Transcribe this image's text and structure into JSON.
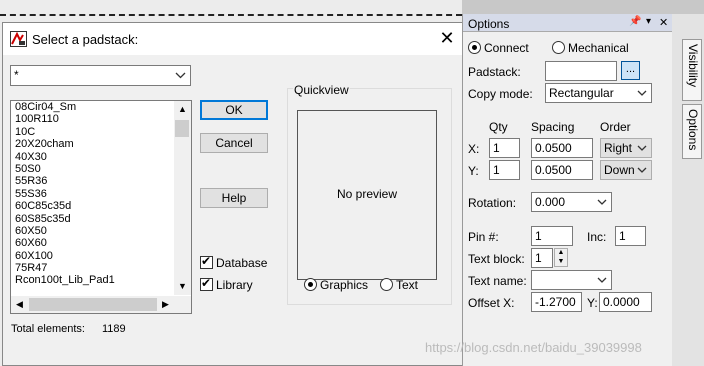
{
  "dialog": {
    "title": "Select a padstack:",
    "filter_value": "*",
    "list_items": [
      "08Cir04_Sm",
      "100R110",
      "10C",
      "20X20cham",
      "40X30",
      "50S0",
      "55R36",
      "55S36",
      "60C85c35d",
      "60S85c35d",
      "60X50",
      "60X60",
      "60X100",
      "75R47",
      "Rcon100t_Lib_Pad1"
    ],
    "buttons": {
      "ok": "OK",
      "cancel": "Cancel",
      "help": "Help"
    },
    "checks": {
      "database": "Database",
      "library": "Library"
    },
    "quickview": {
      "label": "Quickview",
      "preview_text": "No preview",
      "graphics": "Graphics",
      "text": "Text"
    },
    "total_label": "Total elements:",
    "total_value": "1189"
  },
  "options": {
    "title": "Options",
    "connect": "Connect",
    "mechanical": "Mechanical",
    "padstack_label": "Padstack:",
    "padstack_value": "",
    "browse_label": "...",
    "copy_mode_label": "Copy mode:",
    "copy_mode_value": "Rectangular",
    "qty_label": "Qty",
    "spacing_label": "Spacing",
    "order_label": "Order",
    "x_label": "X:",
    "y_label": "Y:",
    "x_qty": "1",
    "y_qty": "1",
    "x_spacing": "0.0500",
    "y_spacing": "0.0500",
    "x_order": "Right",
    "y_order": "Down",
    "rotation_label": "Rotation:",
    "rotation_value": "0.000",
    "pin_label": "Pin #:",
    "pin_value": "1",
    "inc_label": "Inc:",
    "inc_value": "1",
    "text_block_label": "Text block:",
    "text_block_value": "1",
    "text_name_label": "Text name:",
    "text_name_value": "",
    "offset_x_label": "Offset X:",
    "offset_x_value": "-1.2700",
    "offset_y_label": "Y:",
    "offset_y_value": "0.0000"
  },
  "side_tabs": {
    "visibility": "Visibility",
    "options": "Options"
  },
  "watermark": "https://blog.csdn.net/baidu_39039998"
}
